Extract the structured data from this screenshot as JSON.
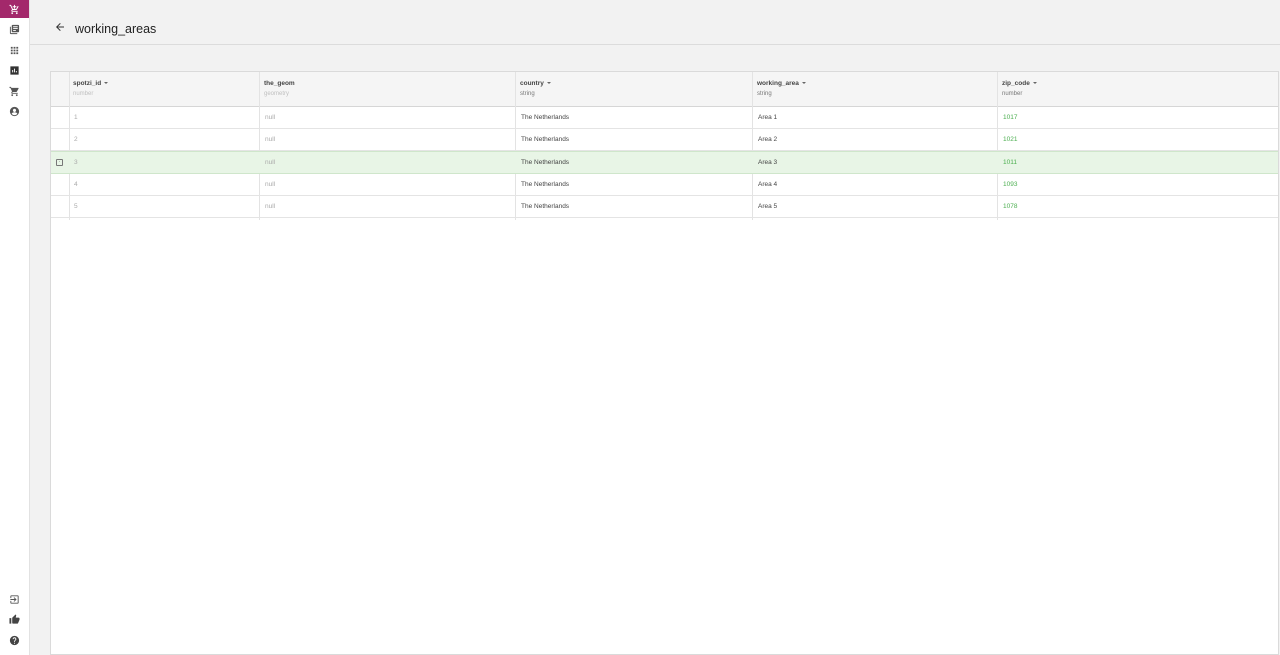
{
  "page": {
    "title": "working_areas"
  },
  "colors": {
    "accent": "#a3286b",
    "zip_value": "#4caf50",
    "selected_row": "#e8f5e6"
  },
  "sidebar": {
    "top_items": [
      {
        "name": "cart-icon",
        "active": true
      },
      {
        "name": "maps-icon"
      },
      {
        "name": "apps-grid-icon"
      },
      {
        "name": "dataset-icon"
      },
      {
        "name": "cart-outline-icon"
      },
      {
        "name": "account-icon"
      }
    ],
    "bottom_items": [
      {
        "name": "logout-icon"
      },
      {
        "name": "thumbs-up-icon"
      },
      {
        "name": "help-icon"
      }
    ]
  },
  "table": {
    "columns": [
      {
        "name": "spotzi_id",
        "type": "number",
        "sortable": true
      },
      {
        "name": "the_geom",
        "type": "geometry",
        "sortable": false
      },
      {
        "name": "country",
        "type": "string",
        "sortable": true
      },
      {
        "name": "working_area",
        "type": "string",
        "sortable": true
      },
      {
        "name": "zip_code",
        "type": "number",
        "sortable": true
      }
    ],
    "rows": [
      {
        "spotzi_id": "1",
        "the_geom": "null",
        "country": "The Netherlands",
        "working_area": "Area 1",
        "zip_code": "1017"
      },
      {
        "spotzi_id": "2",
        "the_geom": "null",
        "country": "The Netherlands",
        "working_area": "Area 2",
        "zip_code": "1021"
      },
      {
        "spotzi_id": "3",
        "the_geom": "null",
        "country": "The Netherlands",
        "working_area": "Area 3",
        "zip_code": "1011",
        "selected": true
      },
      {
        "spotzi_id": "4",
        "the_geom": "null",
        "country": "The Netherlands",
        "working_area": "Area 4",
        "zip_code": "1093"
      },
      {
        "spotzi_id": "5",
        "the_geom": "null",
        "country": "The Netherlands",
        "working_area": "Area 5",
        "zip_code": "1078"
      }
    ]
  }
}
